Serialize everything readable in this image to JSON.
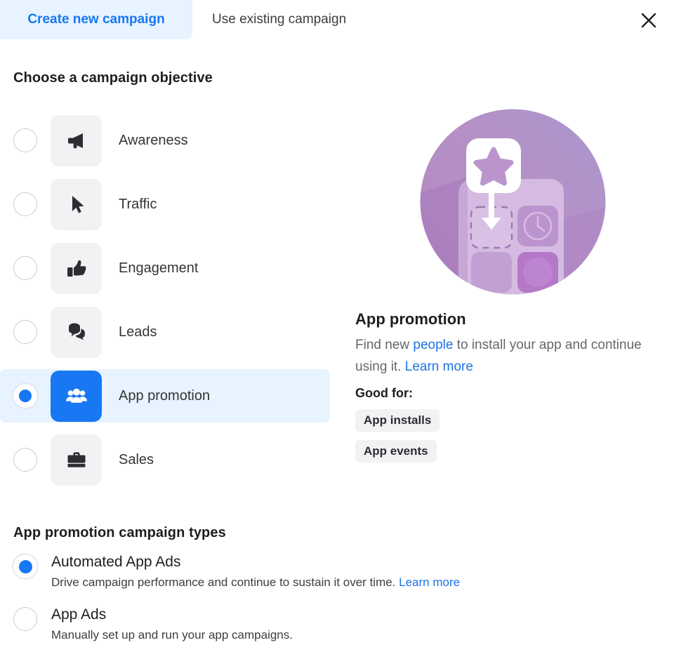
{
  "tabs": [
    {
      "label": "Create new campaign",
      "active": true
    },
    {
      "label": "Use existing campaign",
      "active": false
    }
  ],
  "close_label": "×",
  "objective_section": {
    "title": "Choose a campaign objective",
    "items": [
      {
        "label": "Awareness",
        "icon": "megaphone-icon",
        "selected": false
      },
      {
        "label": "Traffic",
        "icon": "cursor-arrow-icon",
        "selected": false
      },
      {
        "label": "Engagement",
        "icon": "thumbs-up-icon",
        "selected": false
      },
      {
        "label": "Leads",
        "icon": "speech-bubbles-icon",
        "selected": false
      },
      {
        "label": "App promotion",
        "icon": "people-group-icon",
        "selected": true
      },
      {
        "label": "Sales",
        "icon": "briefcase-icon",
        "selected": false
      }
    ]
  },
  "detail": {
    "illustration": "app-promotion-illustration",
    "title": "App promotion",
    "desc_part1": "Find new ",
    "desc_link1": "people",
    "desc_part2": " to install your app and continue using it. ",
    "desc_link2": "Learn more",
    "good_for_label": "Good for:",
    "tags": [
      "App installs",
      "App events"
    ]
  },
  "campaign_types": {
    "title": "App promotion campaign types",
    "items": [
      {
        "name": "Automated App Ads",
        "sub": "Drive campaign performance and continue to sustain it over time. ",
        "sub_link": "Learn more",
        "selected": true
      },
      {
        "name": "App Ads",
        "sub": "Manually set up and run your app campaigns.",
        "sub_link": "",
        "selected": false
      }
    ]
  },
  "colors": {
    "accent_blue": "#1877f2",
    "link_blue": "#1b74e4",
    "tab_active_bg": "#e7f3ff",
    "selected_row_bg": "#e7f3ff",
    "icon_box_bg": "#f1f2f3",
    "illustration_purple": "#b08cc0"
  }
}
